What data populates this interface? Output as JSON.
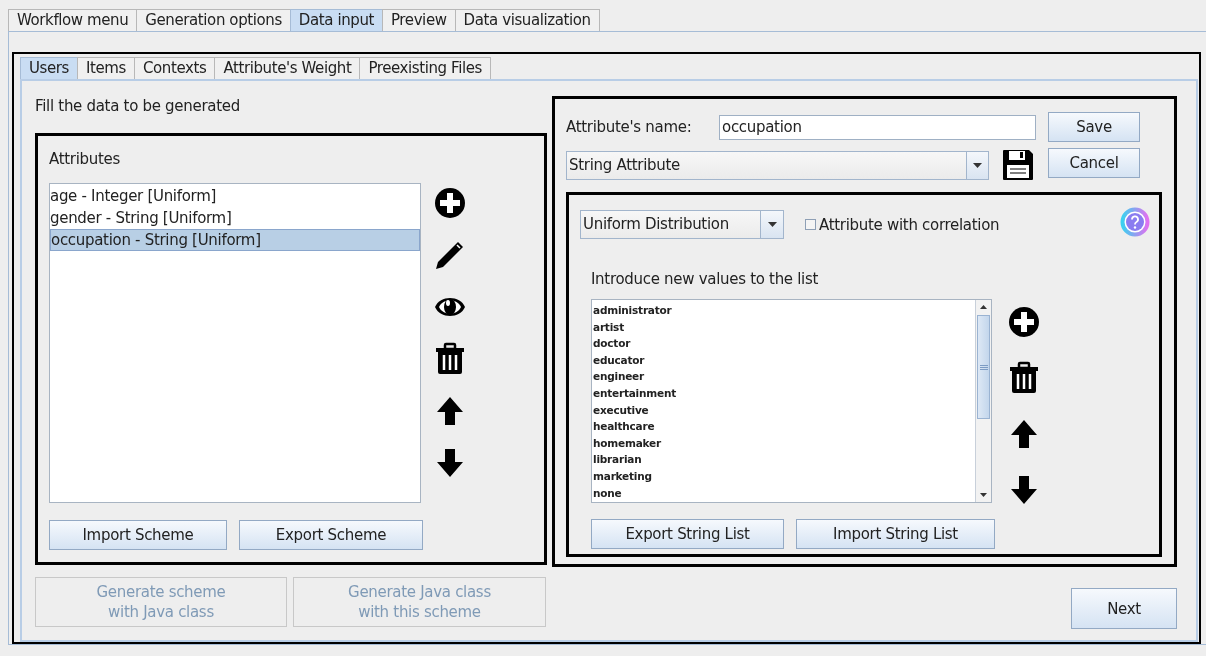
{
  "main_tabs": [
    {
      "label": "Workflow menu",
      "selected": false
    },
    {
      "label": "Generation options",
      "selected": false
    },
    {
      "label": "Data input",
      "selected": true
    },
    {
      "label": "Preview",
      "selected": false
    },
    {
      "label": "Data visualization",
      "selected": false
    }
  ],
  "sub_tabs": [
    {
      "label": "Users",
      "selected": true
    },
    {
      "label": "Items",
      "selected": false
    },
    {
      "label": "Contexts",
      "selected": false
    },
    {
      "label": "Attribute's Weight",
      "selected": false
    },
    {
      "label": "Preexisting Files",
      "selected": false
    }
  ],
  "instruction": "Fill the data to be generated",
  "attributes_panel": {
    "title": "Attributes",
    "items": [
      {
        "label": "age - Integer [Uniform]",
        "selected": false
      },
      {
        "label": "gender - String [Uniform]",
        "selected": false
      },
      {
        "label": "occupation - String [Uniform]",
        "selected": true
      }
    ],
    "buttons": [
      "Import Scheme",
      "Export Scheme"
    ]
  },
  "java_buttons": [
    {
      "lines": [
        "Generate scheme",
        "with Java class"
      ],
      "disabled": true
    },
    {
      "lines": [
        "Generate Java class",
        "with this scheme"
      ],
      "disabled": true
    }
  ],
  "editor": {
    "name_label": "Attribute's name:",
    "name_value": "occupation",
    "type_select": "String Attribute",
    "buttons": [
      "Save",
      "Cancel"
    ],
    "distribution_select": "Uniform Distribution",
    "correlation": {
      "label": "Attribute with correlation",
      "checked": false
    },
    "values_label": "Introduce new values to the list",
    "values": [
      "administrator",
      "artist",
      "doctor",
      "educator",
      "engineer",
      "entertainment",
      "executive",
      "healthcare",
      "homemaker",
      "librarian",
      "marketing",
      "none"
    ],
    "list_buttons": [
      "Export String List",
      "Import String List"
    ]
  },
  "next_button": "Next"
}
